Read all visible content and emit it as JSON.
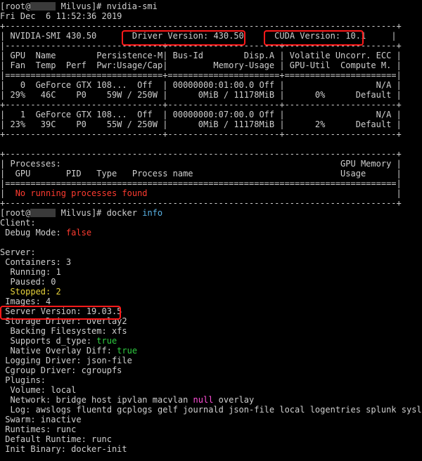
{
  "prompt1": {
    "user": "[root@",
    "host": "Milvus]#",
    "command": "nvidia-smi"
  },
  "timestamp": "Fri Dec  6 11:52:36 2019",
  "smi": {
    "border_top": "+-----------------------------------------------------------------------------+",
    "header_left": "| NVIDIA-SMI 430.50       ",
    "driver_version": "Driver Version: 430.50",
    "header_mid": "      ",
    "cuda_version": "CUDA Version: 10.1",
    "header_right": "     |",
    "sep_dash": "|-------------------------------+----------------------+----------------------+",
    "col_header1": "| GPU  Name        Persistence-M| Bus-Id        Disp.A | Volatile Uncorr. ECC |",
    "col_header2": "| Fan  Temp  Perf  Pwr:Usage/Cap|         Memory-Usage | GPU-Util  Compute M. |",
    "sep_double": "|===============================+======================+======================|",
    "gpu0_line1": "|   0  GeForce GTX 108...  Off  | 00000000:01:00.0 Off |                  N/A |",
    "gpu0_line2": "| 29%   46C    P0    59W / 250W |      0MiB / 11178MiB |      0%      Default |",
    "sep_plus": "+-------------------------------+----------------------+----------------------+",
    "gpu1_line1": "|   1  GeForce GTX 108...  Off  | 00000000:07:00.0 Off |                  N/A |",
    "gpu1_line2": "| 23%   39C    P0    55W / 250W |      0MiB / 11178MiB |      2%      Default |",
    "proc_border": "+-----------------------------------------------------------------------------+",
    "proc_header1": "| Processes:                                                       GPU Memory |",
    "proc_header2": "|  GPU       PID   Type   Process name                             Usage      |",
    "proc_sep": "|=============================================================================|",
    "proc_none_prefix": "|  ",
    "proc_none": "No running processes found",
    "proc_none_suffix": "                                                 |"
  },
  "prompt2": {
    "user": "[root@",
    "host": "Milvus]#",
    "command": "docker",
    "arg": "info"
  },
  "docker": {
    "client": "Client:",
    "debug_label": " Debug Mode: ",
    "debug_value": "false",
    "server": "Server:",
    "containers": " Containers: 3",
    "running": "  Running: 1",
    "paused": "  Paused: 0",
    "stopped": "  Stopped: 2",
    "images": " Images: 4",
    "server_version": " Server Version: 19.03.5",
    "storage_driver": " Storage Driver: overlay2",
    "backing_fs": "  Backing Filesystem: xfs",
    "supports_label": "  Supports d_type: ",
    "supports_value": "true",
    "native_label": "  Native Overlay Diff: ",
    "native_value": "true",
    "logging_driver": " Logging Driver: json-file",
    "cgroup_driver": " Cgroup Driver: cgroupfs",
    "plugins": " Plugins:",
    "volume": "  Volume: local",
    "network_prefix": "  Network: bridge host ipvlan macvlan ",
    "network_null": "null",
    "network_suffix": " overlay",
    "log": "  Log: awslogs fluentd gcplogs gelf journald json-file local logentries splunk syslog",
    "swarm": " Swarm: inactive",
    "runtimes": " Runtimes: runc",
    "default_runtime": " Default Runtime: runc",
    "init_binary": " Init Binary: docker-init"
  },
  "colors": {
    "background": "#000000",
    "text": "#cfcfcf",
    "highlight_box": "#ff1a1a",
    "error_red": "#ff3b30",
    "bool_green": "#2ecc40",
    "stopped_yellow": "#e6d13b",
    "arg_cyan": "#5ab3e6",
    "null_magenta": "#ff4fd8"
  }
}
